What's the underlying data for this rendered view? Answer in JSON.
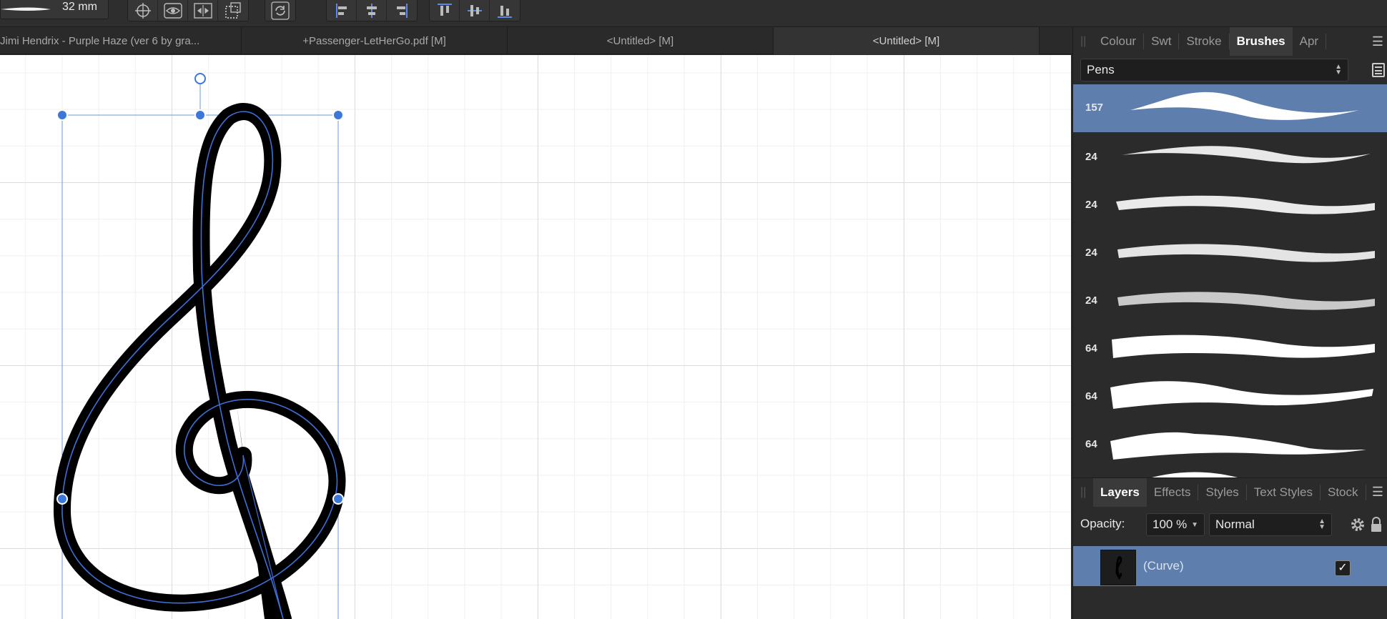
{
  "toolbar": {
    "brush_size": "32 mm",
    "transform_tools": [
      "crosshair-icon",
      "eye-icon",
      "flip-horizontal-icon",
      "transform-origin-icon",
      "rotate-icon"
    ],
    "align_tools": [
      "align-left-icon",
      "align-center-icon",
      "align-right-icon",
      "align-top-icon",
      "align-middle-icon",
      "align-bottom-icon"
    ]
  },
  "tabs": [
    {
      "label": "Jimi Hendrix - Purple Haze (ver 6 by gra...",
      "active": false
    },
    {
      "label": "+Passenger-LetHerGo.pdf [M]",
      "active": false
    },
    {
      "label": "<Untitled> [M]",
      "active": false
    },
    {
      "label": "<Untitled> [M]",
      "active": true
    }
  ],
  "brushes_panel": {
    "tabs": [
      "Colour",
      "Swt",
      "Stroke",
      "Brushes",
      "Apr"
    ],
    "active_tab": "Brushes",
    "category": "Pens",
    "brushes": [
      {
        "size": "157",
        "selected": true
      },
      {
        "size": "24",
        "selected": false
      },
      {
        "size": "24",
        "selected": false
      },
      {
        "size": "24",
        "selected": false
      },
      {
        "size": "24",
        "selected": false
      },
      {
        "size": "64",
        "selected": false
      },
      {
        "size": "64",
        "selected": false
      },
      {
        "size": "64",
        "selected": false
      }
    ]
  },
  "layers_panel": {
    "tabs": [
      "Layers",
      "Effects",
      "Styles",
      "Text Styles",
      "Stock"
    ],
    "active_tab": "Layers",
    "opacity_label": "Opacity:",
    "opacity_value": "100 %",
    "blend_mode": "Normal",
    "layer_name": "(Curve)",
    "layer_visible": true
  },
  "colors": {
    "accent": "#5e7fae",
    "handle": "#3d78d8",
    "stroke": "#000000"
  }
}
